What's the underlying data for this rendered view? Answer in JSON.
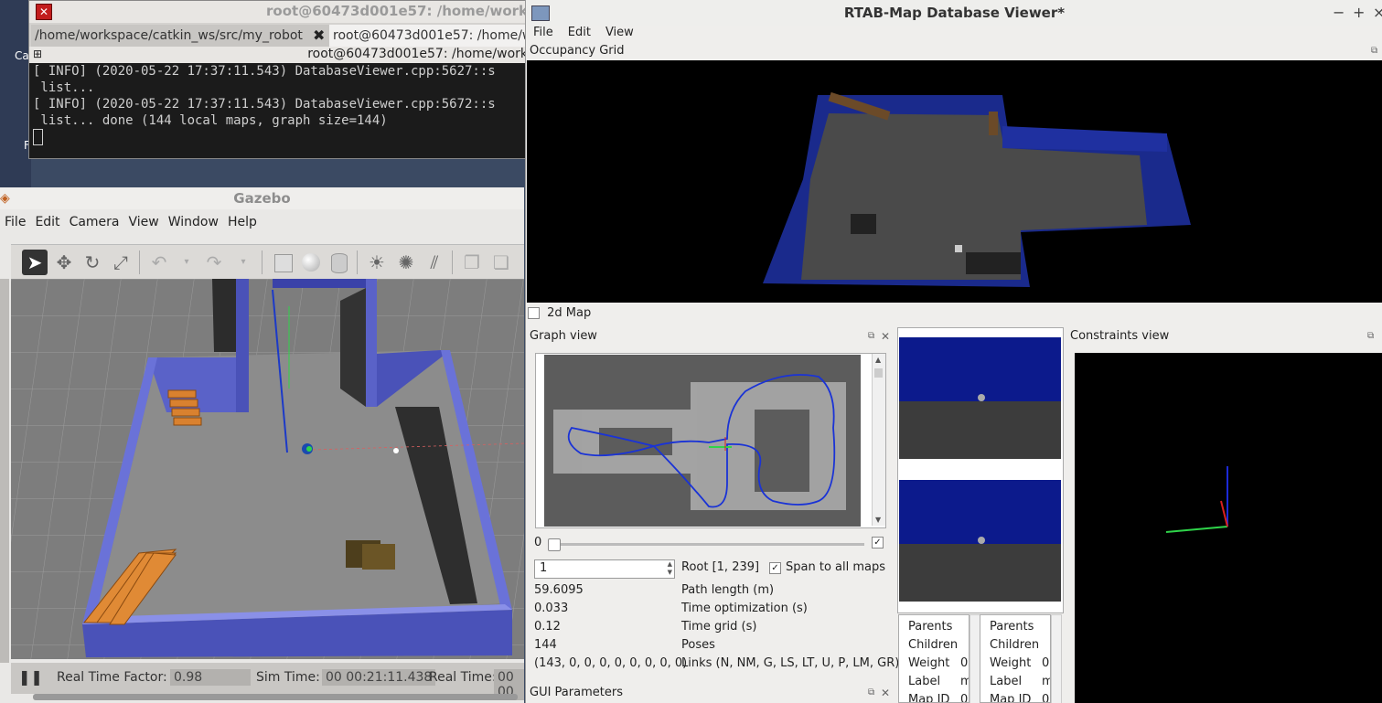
{
  "desktop": {
    "glyphs": [
      "Ca",
      "F"
    ]
  },
  "terminal": {
    "title": "root@60473d001e57: /home/work",
    "tabs": [
      {
        "label": "/home/workspace/catkin_ws/src/my_robot",
        "close": "✖"
      },
      {
        "label": "root@60473d001e57: /home/wo"
      }
    ],
    "subtitle": "root@60473d001e57: /home/work",
    "lines": [
      "[ INFO] (2020-05-22 17:37:11.543) DatabaseViewer.cpp:5627::s",
      " list...",
      "[ INFO] (2020-05-22 17:37:11.543) DatabaseViewer.cpp:5672::s",
      " list... done (144 local maps, graph size=144)"
    ]
  },
  "gazebo": {
    "title": "Gazebo",
    "menu": [
      "File",
      "Edit",
      "Camera",
      "View",
      "Window",
      "Help"
    ],
    "toolbar_icons": [
      "select-arrow-icon",
      "translate-icon",
      "rotate-icon",
      "scale-icon",
      "undo-icon",
      "redo-icon",
      "box-shape-icon",
      "sphere-shape-icon",
      "cylinder-shape-icon",
      "point-light-icon",
      "spot-light-icon",
      "directional-light-icon",
      "copy-icon",
      "paste-icon"
    ],
    "status": {
      "rtf_label": "Real Time Factor:",
      "rtf_value": "0.98",
      "sim_label": "Sim Time:",
      "sim_value": "00 00:21:11.438",
      "real_label": "Real Time:",
      "real_value": "00 00"
    }
  },
  "rtabmap": {
    "title": "RTAB-Map Database Viewer*",
    "window_buttons": [
      "−",
      "+",
      "×"
    ],
    "menu": [
      "File",
      "Edit",
      "View"
    ],
    "occupancy_title": "Occupancy Grid",
    "map2d_label": "2d Map",
    "graph_title": "Graph view",
    "slider_min": "0",
    "slider_value_fraction": 0.0,
    "spin_value": "1",
    "root_label": "Root [1, 239]",
    "span_label": "Span to all maps",
    "span_checked": "✓",
    "stats": [
      {
        "value": "59.6095",
        "label": "Path length (m)"
      },
      {
        "value": "0.033",
        "label": "Time optimization (s)"
      },
      {
        "value": "0.12",
        "label": "Time grid (s)"
      },
      {
        "value": "144",
        "label": "Poses"
      },
      {
        "value": "(143, 0, 0, 0, 0, 0, 0, 0, 0)",
        "label": "Links (N, NM, G, LS, LT, U, P, LM, GR)"
      }
    ],
    "gui_params_title": "GUI Parameters",
    "constraints_title": "Constraints view",
    "props_left": [
      "Parents",
      "Children",
      "Weight",
      "Label",
      "Map ID"
    ],
    "props_left_values": [
      "",
      "",
      "0",
      "m",
      "0"
    ],
    "props_right": [
      "Parents",
      "Children",
      "Weight",
      "Label",
      "Map ID"
    ],
    "props_right_values": [
      "",
      "",
      "0",
      "m",
      "0"
    ],
    "colors": {
      "wall_blue": "#1a2a8c",
      "floor_gray": "#4a4a4a",
      "path_blue": "#1a33d6"
    }
  }
}
